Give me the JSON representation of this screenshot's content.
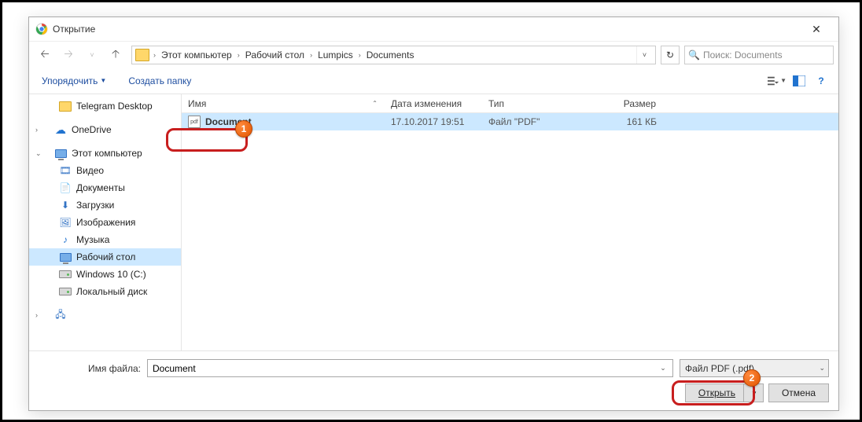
{
  "window": {
    "title": "Открытие"
  },
  "nav": {
    "crumbs": [
      "Этот компьютер",
      "Рабочий стол",
      "Lumpics",
      "Documents"
    ],
    "search_placeholder": "Поиск: Documents"
  },
  "toolbar": {
    "organize": "Упорядочить",
    "new_folder": "Создать папку"
  },
  "sidebar": {
    "items": [
      {
        "label": "Telegram Desktop",
        "icon": "folder",
        "indent": true
      },
      {
        "label": "OneDrive",
        "icon": "cloud"
      },
      {
        "label": "Этот компьютер",
        "icon": "monitor",
        "expanded": true
      },
      {
        "label": "Видео",
        "icon": "video",
        "indent": true
      },
      {
        "label": "Документы",
        "icon": "doc",
        "indent": true
      },
      {
        "label": "Загрузки",
        "icon": "download",
        "indent": true
      },
      {
        "label": "Изображения",
        "icon": "image",
        "indent": true
      },
      {
        "label": "Музыка",
        "icon": "music",
        "indent": true
      },
      {
        "label": "Рабочий стол",
        "icon": "monitor",
        "indent": true,
        "selected": true
      },
      {
        "label": "Windows 10 (C:)",
        "icon": "drive",
        "indent": true
      },
      {
        "label": "Локальный диск",
        "icon": "drive",
        "indent": true
      }
    ]
  },
  "columns": {
    "name": "Имя",
    "date": "Дата изменения",
    "type": "Тип",
    "size": "Размер"
  },
  "files": [
    {
      "name": "Document",
      "date": "17.10.2017 19:51",
      "type": "Файл \"PDF\"",
      "size": "161 КБ"
    }
  ],
  "footer": {
    "filename_label": "Имя файла:",
    "filename_value": "Document",
    "filter": "Файл PDF (.pdf)",
    "open": "Открыть",
    "cancel": "Отмена"
  },
  "annotations": {
    "badge1": "1",
    "badge2": "2"
  }
}
